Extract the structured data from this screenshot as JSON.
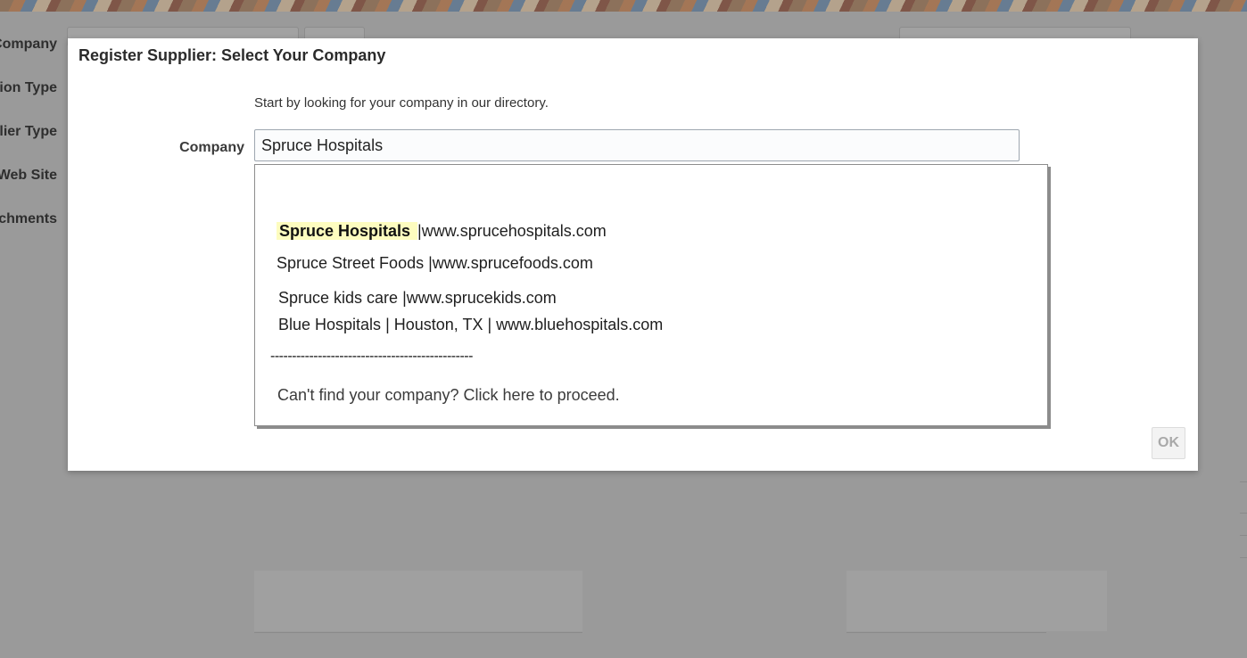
{
  "background": {
    "labels": [
      "Company",
      "ion Type",
      "lier Type",
      "Web Site",
      "chments"
    ]
  },
  "dialog": {
    "title": "Register Supplier: Select Your Company",
    "intro": "Start by looking for your company in our directory.",
    "company_label": "Company",
    "company_value": "Spruce Hospitals",
    "ok_label": "OK"
  },
  "suggestions": {
    "items": [
      {
        "name": "Spruce Hospitals",
        "rest": "|www.sprucehospitals.com"
      },
      {
        "name": "Spruce Street Foods",
        "rest": "|www.sprucefoods.com"
      },
      {
        "name": "Spruce kids care",
        "rest": "|www.sprucekids.com"
      },
      {
        "name": "Blue Hospitals",
        "rest": "| Houston, TX | www.bluehospitals.com"
      }
    ],
    "divider": "-----------------------------------------------",
    "proceed": "Can't find your company? Click here to proceed."
  },
  "colors": {
    "overlay": "#9a9a9a",
    "highlight": "#fdfcbf"
  }
}
